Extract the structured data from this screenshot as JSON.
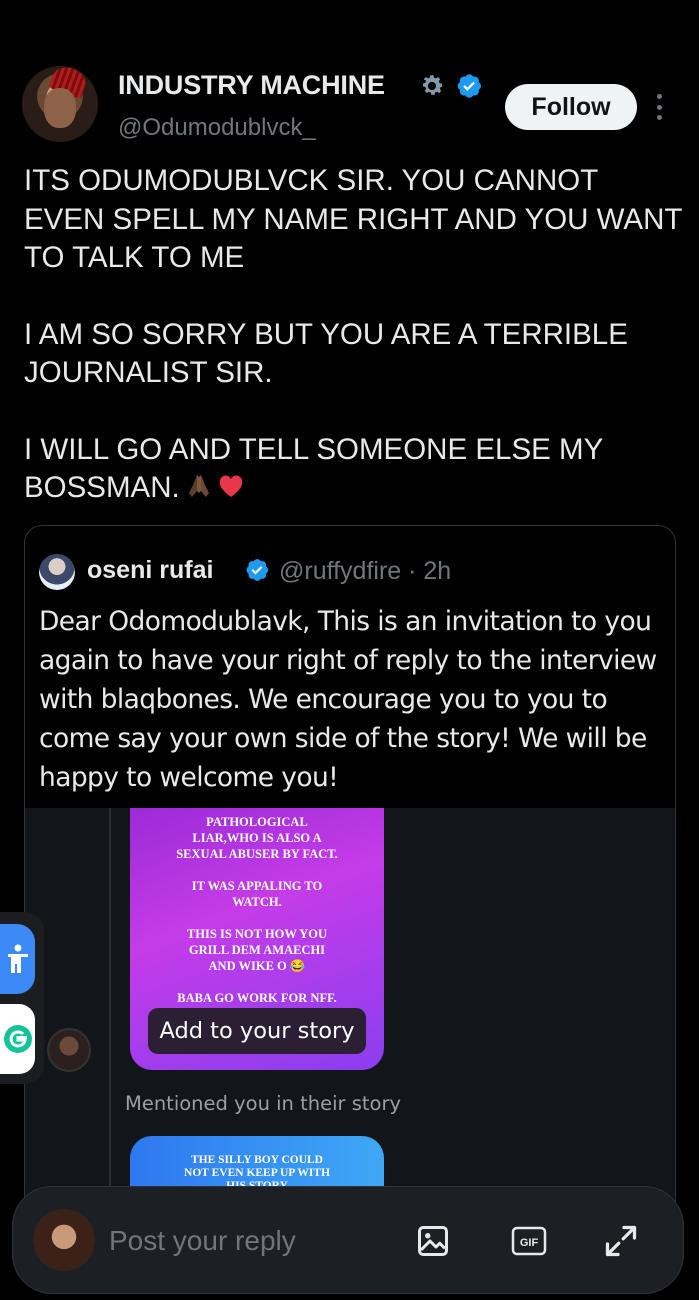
{
  "author": {
    "name": "INDUSTRY MACHINE",
    "handle": "@Odumodublvck_",
    "follow_label": "Follow"
  },
  "post": {
    "paragraphs": [
      "ITS ODUMODUBLVCK SIR. YOU CANNOT EVEN SPELL MY NAME RIGHT AND YOU WANT TO TALK TO ME",
      "I AM SO SORRY BUT YOU ARE A TERRIBLE JOURNALIST SIR.",
      "I WILL GO AND TELL SOMEONE ELSE MY BOSSMAN."
    ]
  },
  "quote": {
    "name": "oseni rufai",
    "handle_time": "@ruffydfire · 2h",
    "text": "Dear Odomodublavk, This is an invitation to you again to have your right of reply to the interview with blaqbones. We encourage you to you to come say your own side of the story! We will be happy to welcome you!",
    "story": {
      "lines": [
        "PATHOLOGICAL",
        "LIAR,WHO IS ALSO A",
        "SEXUAL ABUSER BY FACT.",
        "IT WAS APPALING TO",
        "WATCH.",
        "THIS IS NOT HOW YOU",
        "GRILL DEM AMAECHI",
        "AND WIKE O 😂",
        "BABA GO WORK FOR NFF."
      ],
      "add_label": "Add to your story",
      "mentioned": "Mentioned you in their story",
      "second_lines": [
        "THE SILLY BOY COULD",
        "NOT EVEN KEEP UP WITH",
        "HIS STORY"
      ]
    }
  },
  "reply": {
    "placeholder": "Post your reply",
    "gif_label": "GIF"
  },
  "icons": {
    "gear": "gear-icon",
    "verified": "verified-badge-icon",
    "more": "more-vertical-icon",
    "image": "image-icon",
    "gif": "gif-icon",
    "expand": "expand-icon",
    "accessibility": "accessibility-icon",
    "grammarly": "grammarly-icon"
  },
  "colors": {
    "background": "#000000",
    "verified_blue": "#1d9bf0",
    "text": "#e7e9ea",
    "muted": "#71767b"
  }
}
